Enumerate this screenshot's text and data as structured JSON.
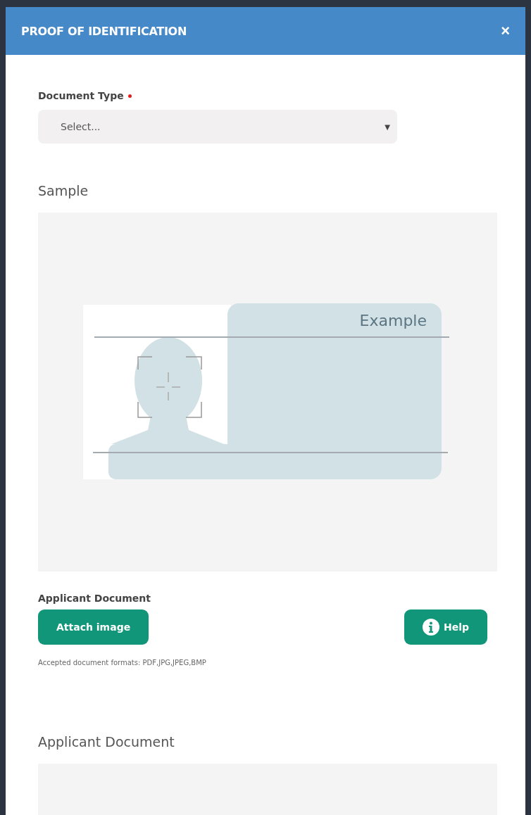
{
  "dialog": {
    "title": "PROOF OF IDENTIFICATION",
    "close": "×"
  },
  "document_type": {
    "label": "Document Type",
    "required": true,
    "placeholder": "Select...",
    "caret": "▼"
  },
  "sample": {
    "heading": "Sample",
    "card_text": "Example"
  },
  "upload": {
    "label": "Applicant Document",
    "attach_button": "Attach image",
    "help_button": "Help",
    "formats": "Accepted document formats: PDF,JPG,JPEG,BMP"
  },
  "preview": {
    "heading": "Applicant Document"
  }
}
